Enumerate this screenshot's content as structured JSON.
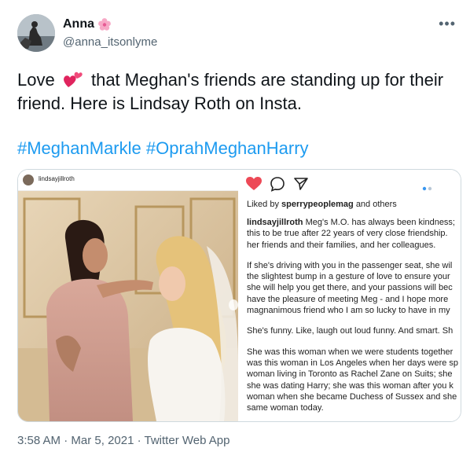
{
  "author": {
    "display_name": "Anna",
    "handle": "@anna_itsonlyme",
    "name_emoji_icon": "cherry-blossom-icon",
    "avatar_icon": "avatar-photo"
  },
  "tweet": {
    "text_before_emoji": "Love",
    "emoji_icon": "two-hearts-icon",
    "text_after_emoji": "that Meghan's friends are standing up for their friend. Here is Lindsay Roth on Insta.",
    "hashtags": [
      "#MeghanMarkle",
      "#OprahMeghanHarry"
    ]
  },
  "instagram": {
    "username": "lindsayjillroth",
    "liked_prefix": "Liked by",
    "liked_user": "sperrypeoplemag",
    "liked_suffix": "and others",
    "caption_user": "lindsayjillroth",
    "caption_lines": [
      [
        "Meg's M.O. has always been kindness;",
        "this to be true after 22 years of very close friendship.",
        "her friends and their families, and her colleagues."
      ],
      [
        "If she's driving with you in the passenger seat, she wil",
        "the slightest bump in a gesture of love to ensure your",
        "she will help you get there, and your passions will bec",
        "have the pleasure of meeting Meg - and I hope more",
        "magnanimous friend who I am so lucky to have in my"
      ],
      [
        "She's funny. Like, laugh out loud funny. And smart. Sh"
      ],
      [
        "She was this woman when we were students together",
        "was this woman in Los Angeles when her days were sp",
        "woman living in Toronto as Rachel Zane on Suits; she",
        "she was dating Harry; she was this woman after you k",
        "woman when she became Duchess of Sussex and she",
        "same woman today."
      ]
    ]
  },
  "meta": {
    "time": "3:58 AM",
    "separator": "·",
    "date": "Mar 5, 2021",
    "source": "Twitter Web App"
  },
  "colors": {
    "link": "#1d9bf0",
    "secondary_text": "#536471",
    "like_heart": "#ed4956"
  }
}
